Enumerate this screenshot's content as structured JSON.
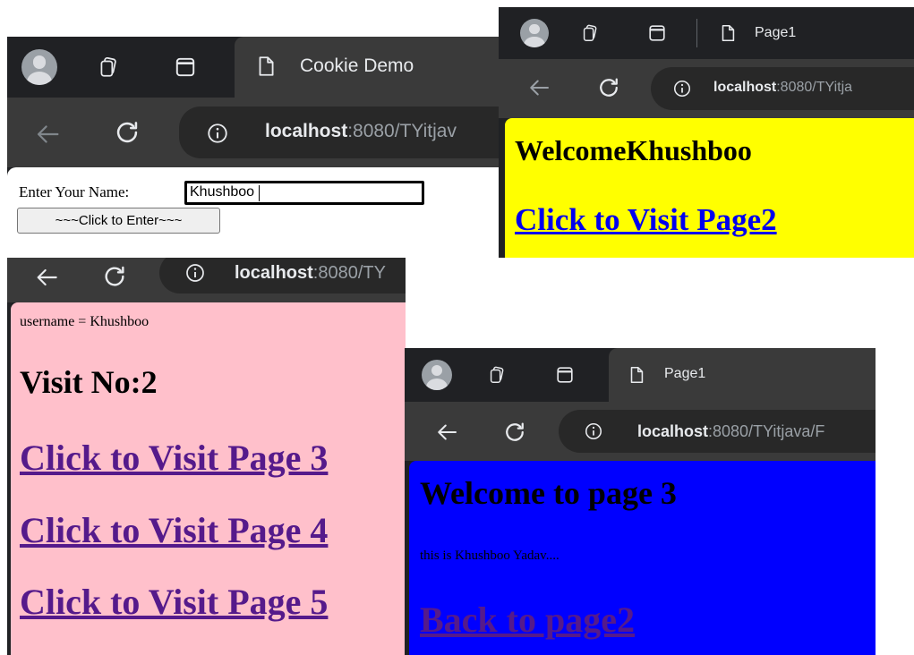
{
  "win_cookie_demo": {
    "tab_title": "Cookie Demo",
    "url_host": "localhost",
    "url_rest": ":8080/TYitjav",
    "form": {
      "name_label": "Enter Your Name:",
      "name_value": "Khushboo",
      "submit_label": "~~~Click to Enter~~~"
    }
  },
  "win_page1": {
    "tab_title": "Page1",
    "url_host": "localhost",
    "url_rest": ":8080/TYitja",
    "heading": "WelcomeKhushboo",
    "link_text": "Click to Visit Page2",
    "bg_color": "#ffff00"
  },
  "win_page2": {
    "url_host": "localhost",
    "url_rest": ":8080/TY",
    "username_line": "username = Khushboo",
    "visit_heading": "Visit No:2",
    "links": [
      "Click to Visit Page 3",
      "Click to Visit Page 4",
      "Click to Visit Page 5"
    ],
    "bg_color": "#ffc0cb"
  },
  "win_page3": {
    "tab_title": "Page1",
    "url_host": "localhost",
    "url_rest": ":8080/TYitjava/F",
    "heading": "Welcome to page 3",
    "body_text": "this is Khushboo Yadav....",
    "link_text": "Back to page2",
    "bg_color": "#0000ff"
  },
  "icons": [
    "profile-avatar",
    "collections-icon",
    "tab-actions-icon",
    "page-icon",
    "back-arrow-icon",
    "reload-icon",
    "info-icon"
  ]
}
